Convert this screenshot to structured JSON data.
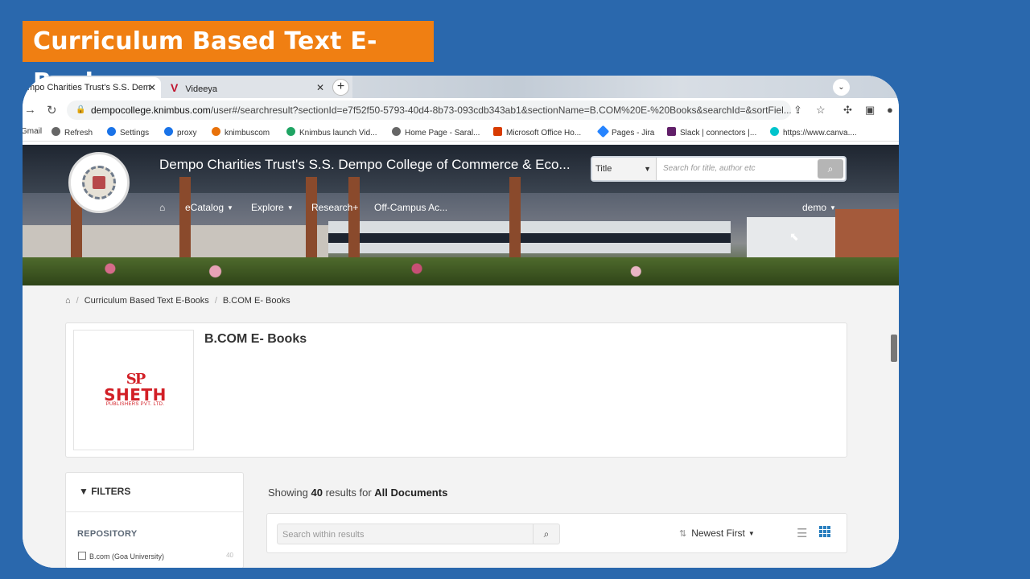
{
  "banner": {
    "title": "Curriculum Based Text E-Books",
    "color": "#f07f12"
  },
  "browser": {
    "tabs": [
      {
        "label": "mpo Charities Trust's S.S. Dem",
        "close": "✕"
      },
      {
        "label": "Videeya",
        "logo": "V",
        "close": "✕"
      }
    ],
    "new_tab": "+",
    "tab_menu": "⌄",
    "url_host": "dempocollege.knimbus.com",
    "url_path": "/user#/searchresult?sectionId=e7f52f50-5793-40d4-8b73-093cdb343ab1&sectionName=B.COM%20E-%20Books&searchId=&sortFiel...",
    "bookmarks": [
      {
        "label": "Gmail",
        "icon": "mail-icon",
        "color": "#d93025"
      },
      {
        "label": "Refresh",
        "icon": "globe-icon",
        "color": "#555555"
      },
      {
        "label": "Settings",
        "icon": "gear-icon",
        "color": "#1a73e8"
      },
      {
        "label": "proxy",
        "icon": "gear-icon",
        "color": "#1a73e8"
      },
      {
        "label": "knimbuscom",
        "icon": "infinity-icon",
        "color": "#e8710a"
      },
      {
        "label": "Knimbus launch Vid...",
        "icon": "drive-icon",
        "color": "#1fa463"
      },
      {
        "label": "Home Page - Saral...",
        "icon": "globe-icon",
        "color": "#555555"
      },
      {
        "label": "Microsoft Office Ho...",
        "icon": "office-icon",
        "color": "#d83b01"
      },
      {
        "label": "Pages - Jira",
        "icon": "jira-icon",
        "color": "#2684ff"
      },
      {
        "label": "Slack | connectors |...",
        "icon": "slack-icon",
        "color": "#611f69"
      },
      {
        "label": "https://www.canva....",
        "icon": "canva-icon",
        "color": "#00c4cc"
      }
    ]
  },
  "site": {
    "college": "Dempo Charities Trust's S.S. Dempo College of Commerce & Eco...",
    "search": {
      "field": "Title",
      "placeholder": "Search for title, author etc"
    },
    "menu": [
      {
        "label": "eCatalog",
        "caret": true
      },
      {
        "label": "Explore",
        "caret": true
      },
      {
        "label": "Research+",
        "caret": false
      },
      {
        "label": "Off-Campus Ac...",
        "caret": false
      }
    ],
    "user": "demo"
  },
  "breadcrumb": [
    "Curriculum Based Text E-Books",
    "B.COM E- Books"
  ],
  "collection": {
    "title": "B.COM E- Books",
    "publisher_logo": {
      "mark": "SP",
      "name": "SHETH",
      "sub": "PUBLISHERS PVT. LTD."
    }
  },
  "filters": {
    "title": "FILTERS",
    "section": "REPOSITORY",
    "options": [
      {
        "label": "B.com (Goa University)",
        "count": "40"
      }
    ]
  },
  "results": {
    "showing_prefix": "Showing",
    "count": "40",
    "middle": "results for",
    "scope": "All Documents",
    "search_placeholder": "Search within results",
    "sort": "Newest First"
  }
}
